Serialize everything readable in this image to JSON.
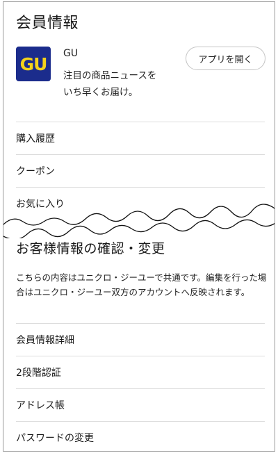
{
  "page": {
    "title": "会員情報"
  },
  "app_promo": {
    "icon_text": "GU",
    "icon_colors": {
      "background": "#1b2c8c",
      "text": "#f4d21a"
    },
    "name": "GU",
    "description_line1": "注目の商品ニュースを",
    "description_line2": "いち早くお届け。",
    "open_button_label": "アプリを開く"
  },
  "menu_top": {
    "items": [
      {
        "label": "購入履歴"
      },
      {
        "label": "クーポン"
      },
      {
        "label": "お気に入り"
      }
    ]
  },
  "account_section": {
    "title": "お客様情報の確認・変更",
    "description": "こちらの内容はユニクロ・ジーユーで共通です。編集を行った場合はユニクロ・ジーユー双方のアカウントへ反映されます。"
  },
  "menu_bottom": {
    "items": [
      {
        "label": "会員情報詳細"
      },
      {
        "label": "2段階認証"
      },
      {
        "label": "アドレス帳"
      },
      {
        "label": "パスワードの変更"
      }
    ]
  }
}
